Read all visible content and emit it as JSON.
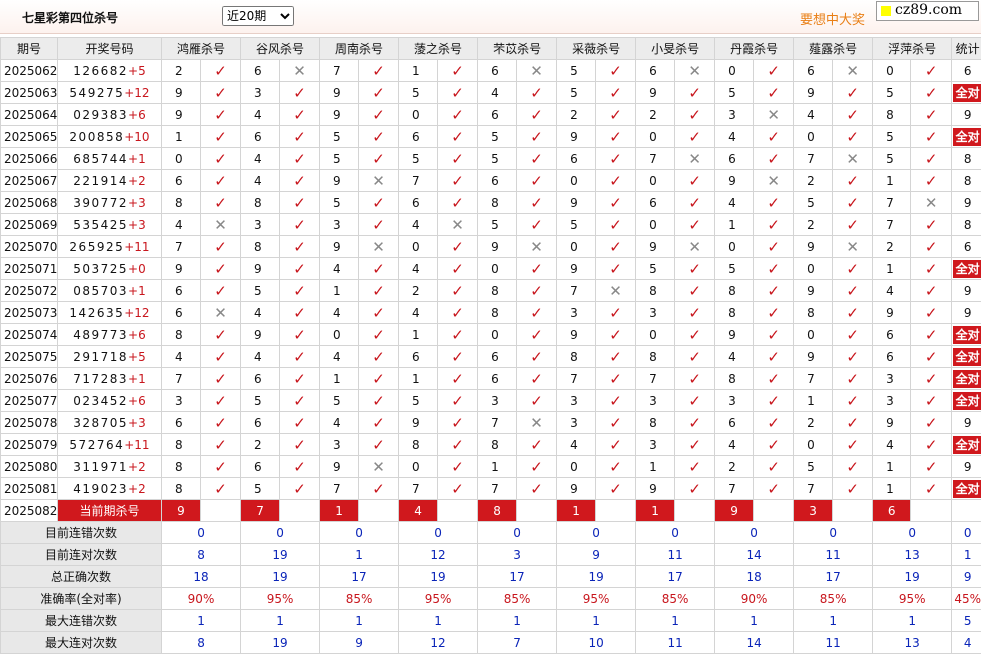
{
  "title": "七星彩第四位杀号",
  "period_selector": {
    "selected": "近20期"
  },
  "slogan": "要想中大奖",
  "logo_text": "cz89.com",
  "headers": [
    "期号",
    "开奖号码",
    "鸿雁杀号",
    "谷风杀号",
    "周南杀号",
    "蔆之杀号",
    "芣苡杀号",
    "采薇杀号",
    "小旻杀号",
    "丹霞杀号",
    "薤露杀号",
    "浮萍杀号",
    "统计"
  ],
  "mark_ok": "✓",
  "mark_ng": "✕",
  "allright_label": "全对",
  "rows": [
    {
      "issue": "2025062",
      "draw": "126682",
      "bonus": "+5",
      "kills": [
        [
          2,
          1
        ],
        [
          6,
          0
        ],
        [
          7,
          1
        ],
        [
          1,
          1
        ],
        [
          6,
          0
        ],
        [
          5,
          1
        ],
        [
          6,
          0
        ],
        [
          0,
          1
        ],
        [
          6,
          0
        ],
        [
          0,
          1
        ]
      ],
      "stat": "6"
    },
    {
      "issue": "2025063",
      "draw": "549275",
      "bonus": "+12",
      "kills": [
        [
          9,
          1
        ],
        [
          3,
          1
        ],
        [
          9,
          1
        ],
        [
          5,
          1
        ],
        [
          4,
          1
        ],
        [
          5,
          1
        ],
        [
          9,
          1
        ],
        [
          5,
          1
        ],
        [
          9,
          1
        ],
        [
          5,
          1
        ]
      ],
      "stat": "全对"
    },
    {
      "issue": "2025064",
      "draw": "029383",
      "bonus": "+6",
      "kills": [
        [
          9,
          1
        ],
        [
          4,
          1
        ],
        [
          9,
          1
        ],
        [
          0,
          1
        ],
        [
          6,
          1
        ],
        [
          2,
          1
        ],
        [
          2,
          1
        ],
        [
          3,
          0
        ],
        [
          4,
          1
        ],
        [
          8,
          1
        ]
      ],
      "stat": "9"
    },
    {
      "issue": "2025065",
      "draw": "200858",
      "bonus": "+10",
      "kills": [
        [
          1,
          1
        ],
        [
          6,
          1
        ],
        [
          5,
          1
        ],
        [
          6,
          1
        ],
        [
          5,
          1
        ],
        [
          9,
          1
        ],
        [
          0,
          1
        ],
        [
          4,
          1
        ],
        [
          0,
          1
        ],
        [
          5,
          1
        ]
      ],
      "stat": "全对"
    },
    {
      "issue": "2025066",
      "draw": "685744",
      "bonus": "+1",
      "kills": [
        [
          0,
          1
        ],
        [
          4,
          1
        ],
        [
          5,
          1
        ],
        [
          5,
          1
        ],
        [
          5,
          1
        ],
        [
          6,
          1
        ],
        [
          7,
          0
        ],
        [
          6,
          1
        ],
        [
          7,
          0
        ],
        [
          5,
          1
        ]
      ],
      "stat": "8"
    },
    {
      "issue": "2025067",
      "draw": "221914",
      "bonus": "+2",
      "kills": [
        [
          6,
          1
        ],
        [
          4,
          1
        ],
        [
          9,
          0
        ],
        [
          7,
          1
        ],
        [
          6,
          1
        ],
        [
          0,
          1
        ],
        [
          0,
          1
        ],
        [
          9,
          0
        ],
        [
          2,
          1
        ],
        [
          1,
          1
        ]
      ],
      "stat": "8"
    },
    {
      "issue": "2025068",
      "draw": "390772",
      "bonus": "+3",
      "kills": [
        [
          8,
          1
        ],
        [
          8,
          1
        ],
        [
          5,
          1
        ],
        [
          6,
          1
        ],
        [
          8,
          1
        ],
        [
          9,
          1
        ],
        [
          6,
          1
        ],
        [
          4,
          1
        ],
        [
          5,
          1
        ],
        [
          7,
          0
        ]
      ],
      "stat": "9"
    },
    {
      "issue": "2025069",
      "draw": "535425",
      "bonus": "+3",
      "kills": [
        [
          4,
          0
        ],
        [
          3,
          1
        ],
        [
          3,
          1
        ],
        [
          4,
          0
        ],
        [
          5,
          1
        ],
        [
          5,
          1
        ],
        [
          0,
          1
        ],
        [
          1,
          1
        ],
        [
          2,
          1
        ],
        [
          7,
          1
        ]
      ],
      "stat": "8"
    },
    {
      "issue": "2025070",
      "draw": "265925",
      "bonus": "+11",
      "kills": [
        [
          7,
          1
        ],
        [
          8,
          1
        ],
        [
          9,
          0
        ],
        [
          0,
          1
        ],
        [
          9,
          0
        ],
        [
          0,
          1
        ],
        [
          9,
          0
        ],
        [
          0,
          1
        ],
        [
          9,
          0
        ],
        [
          2,
          1
        ]
      ],
      "stat": "6"
    },
    {
      "issue": "2025071",
      "draw": "503725",
      "bonus": "+0",
      "kills": [
        [
          9,
          1
        ],
        [
          9,
          1
        ],
        [
          4,
          1
        ],
        [
          4,
          1
        ],
        [
          0,
          1
        ],
        [
          9,
          1
        ],
        [
          5,
          1
        ],
        [
          5,
          1
        ],
        [
          0,
          1
        ],
        [
          1,
          1
        ]
      ],
      "stat": "全对"
    },
    {
      "issue": "2025072",
      "draw": "085703",
      "bonus": "+1",
      "kills": [
        [
          6,
          1
        ],
        [
          5,
          1
        ],
        [
          1,
          1
        ],
        [
          2,
          1
        ],
        [
          8,
          1
        ],
        [
          7,
          0
        ],
        [
          8,
          1
        ],
        [
          8,
          1
        ],
        [
          9,
          1
        ],
        [
          4,
          1
        ]
      ],
      "stat": "9"
    },
    {
      "issue": "2025073",
      "draw": "142635",
      "bonus": "+12",
      "kills": [
        [
          6,
          0
        ],
        [
          4,
          1
        ],
        [
          4,
          1
        ],
        [
          4,
          1
        ],
        [
          8,
          1
        ],
        [
          3,
          1
        ],
        [
          3,
          1
        ],
        [
          8,
          1
        ],
        [
          8,
          1
        ],
        [
          9,
          1
        ]
      ],
      "stat": "9"
    },
    {
      "issue": "2025074",
      "draw": "489773",
      "bonus": "+6",
      "kills": [
        [
          8,
          1
        ],
        [
          9,
          1
        ],
        [
          0,
          1
        ],
        [
          1,
          1
        ],
        [
          0,
          1
        ],
        [
          9,
          1
        ],
        [
          0,
          1
        ],
        [
          9,
          1
        ],
        [
          0,
          1
        ],
        [
          6,
          1
        ]
      ],
      "stat": "全对"
    },
    {
      "issue": "2025075",
      "draw": "291718",
      "bonus": "+5",
      "kills": [
        [
          4,
          1
        ],
        [
          4,
          1
        ],
        [
          4,
          1
        ],
        [
          6,
          1
        ],
        [
          6,
          1
        ],
        [
          8,
          1
        ],
        [
          8,
          1
        ],
        [
          4,
          1
        ],
        [
          9,
          1
        ],
        [
          6,
          1
        ]
      ],
      "stat": "全对"
    },
    {
      "issue": "2025076",
      "draw": "717283",
      "bonus": "+1",
      "kills": [
        [
          7,
          1
        ],
        [
          6,
          1
        ],
        [
          1,
          1
        ],
        [
          1,
          1
        ],
        [
          6,
          1
        ],
        [
          7,
          1
        ],
        [
          7,
          1
        ],
        [
          8,
          1
        ],
        [
          7,
          1
        ],
        [
          3,
          1
        ]
      ],
      "stat": "全对"
    },
    {
      "issue": "2025077",
      "draw": "023452",
      "bonus": "+6",
      "kills": [
        [
          3,
          1
        ],
        [
          5,
          1
        ],
        [
          5,
          1
        ],
        [
          5,
          1
        ],
        [
          3,
          1
        ],
        [
          3,
          1
        ],
        [
          3,
          1
        ],
        [
          3,
          1
        ],
        [
          1,
          1
        ],
        [
          3,
          1
        ]
      ],
      "stat": "全对"
    },
    {
      "issue": "2025078",
      "draw": "328705",
      "bonus": "+3",
      "kills": [
        [
          6,
          1
        ],
        [
          6,
          1
        ],
        [
          4,
          1
        ],
        [
          9,
          1
        ],
        [
          7,
          0
        ],
        [
          3,
          1
        ],
        [
          8,
          1
        ],
        [
          6,
          1
        ],
        [
          2,
          1
        ],
        [
          9,
          1
        ]
      ],
      "stat": "9"
    },
    {
      "issue": "2025079",
      "draw": "572764",
      "bonus": "+11",
      "kills": [
        [
          8,
          1
        ],
        [
          2,
          1
        ],
        [
          3,
          1
        ],
        [
          8,
          1
        ],
        [
          8,
          1
        ],
        [
          4,
          1
        ],
        [
          3,
          1
        ],
        [
          4,
          1
        ],
        [
          0,
          1
        ],
        [
          4,
          1
        ]
      ],
      "stat": "全对"
    },
    {
      "issue": "2025080",
      "draw": "311971",
      "bonus": "+2",
      "kills": [
        [
          8,
          1
        ],
        [
          6,
          1
        ],
        [
          9,
          0
        ],
        [
          0,
          1
        ],
        [
          1,
          1
        ],
        [
          0,
          1
        ],
        [
          1,
          1
        ],
        [
          2,
          1
        ],
        [
          5,
          1
        ],
        [
          1,
          1
        ]
      ],
      "stat": "9"
    },
    {
      "issue": "2025081",
      "draw": "419023",
      "bonus": "+2",
      "kills": [
        [
          8,
          1
        ],
        [
          5,
          1
        ],
        [
          7,
          1
        ],
        [
          7,
          1
        ],
        [
          7,
          1
        ],
        [
          9,
          1
        ],
        [
          9,
          1
        ],
        [
          7,
          1
        ],
        [
          7,
          1
        ],
        [
          1,
          1
        ]
      ],
      "stat": "全对"
    }
  ],
  "current": {
    "issue": "2025082",
    "label": "当前期杀号",
    "values": [
      "9",
      "7",
      "1",
      "4",
      "8",
      "1",
      "1",
      "9",
      "3",
      "6"
    ]
  },
  "stats": [
    {
      "label": "目前连错次数",
      "values": [
        "0",
        "0",
        "0",
        "0",
        "0",
        "0",
        "0",
        "0",
        "0",
        "0"
      ],
      "total": "0",
      "color": "blue"
    },
    {
      "label": "目前连对次数",
      "values": [
        "8",
        "19",
        "1",
        "12",
        "3",
        "9",
        "11",
        "14",
        "11",
        "13"
      ],
      "total": "1",
      "color": "blue"
    },
    {
      "label": "总正确次数",
      "values": [
        "18",
        "19",
        "17",
        "19",
        "17",
        "19",
        "17",
        "18",
        "17",
        "19"
      ],
      "total": "9",
      "color": "blue"
    },
    {
      "label": "准确率(全对率)",
      "values": [
        "90%",
        "95%",
        "85%",
        "95%",
        "85%",
        "95%",
        "85%",
        "90%",
        "85%",
        "95%"
      ],
      "total": "45%",
      "color": "red"
    },
    {
      "label": "最大连错次数",
      "values": [
        "1",
        "1",
        "1",
        "1",
        "1",
        "1",
        "1",
        "1",
        "1",
        "1"
      ],
      "total": "5",
      "color": "blue"
    },
    {
      "label": "最大连对次数",
      "values": [
        "8",
        "19",
        "9",
        "12",
        "7",
        "10",
        "11",
        "14",
        "11",
        "13"
      ],
      "total": "4",
      "color": "blue"
    }
  ]
}
